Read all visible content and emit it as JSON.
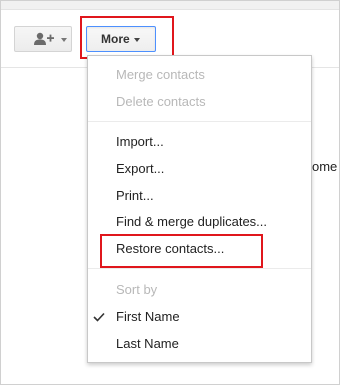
{
  "toolbar": {
    "add_contact_icon": "person-add-icon",
    "more_label": "More"
  },
  "background": {
    "partial_text": "ome t"
  },
  "menu": {
    "merge_contacts": "Merge contacts",
    "delete_contacts": "Delete contacts",
    "import": "Import...",
    "export": "Export...",
    "print": "Print...",
    "find_merge_duplicates": "Find & merge duplicates...",
    "restore_contacts": "Restore contacts...",
    "sort_by": "Sort by",
    "first_name": "First Name",
    "last_name": "Last Name",
    "selected_sort": "First Name"
  },
  "colors": {
    "highlight": "#e0161c",
    "focus_border": "#4d90fe",
    "disabled_text": "#b8b8b8"
  }
}
